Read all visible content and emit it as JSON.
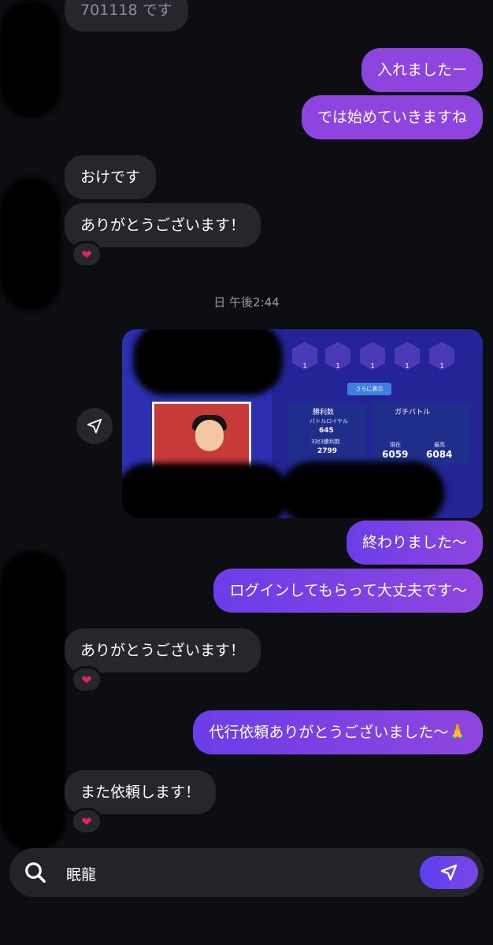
{
  "messages": [
    {
      "id": "m0",
      "side": "in",
      "text": "701118 です"
    },
    {
      "id": "m1",
      "side": "out",
      "text": "入れましたー"
    },
    {
      "id": "m2",
      "side": "out",
      "text": "では始めていきますね"
    },
    {
      "id": "m3",
      "side": "in",
      "text": "おけです"
    },
    {
      "id": "m4",
      "side": "in",
      "text": "ありがとうございます！",
      "reaction": "❤"
    },
    {
      "id": "m5",
      "side": "out",
      "text": "終わりました〜"
    },
    {
      "id": "m6",
      "side": "out",
      "text": "ログインしてもらって大丈夫です〜"
    },
    {
      "id": "m7",
      "side": "in",
      "text": "ありがとうございます！",
      "reaction": "❤"
    },
    {
      "id": "m8",
      "side": "out",
      "text": "代行依頼ありがとうございました〜🙏"
    },
    {
      "id": "m9",
      "side": "in",
      "text": "また依頼します！",
      "reaction": "❤"
    }
  ],
  "timestamp": "日 午後2:44",
  "attachment": {
    "type": "game-screenshot",
    "rank_badges": [
      "1",
      "1",
      "1",
      "1",
      "1"
    ],
    "more_button": "さらに表示",
    "wins_title": "勝利数",
    "battle_royale_label": "バトルロイヤル",
    "battle_royale_wins": "645",
    "trio_label": "3対3勝利数",
    "trio_wins": "2799",
    "ranked_title": "ガチバトル",
    "current_label": "現在",
    "current_value": "6059",
    "highest_label": "最高",
    "highest_value": "6084"
  },
  "input": {
    "value": "眠龍"
  },
  "icons": {
    "search": "search-icon",
    "send": "send-icon",
    "share": "share-icon",
    "reaction": "heart-icon"
  },
  "colors": {
    "background": "#0d0e12",
    "incoming": "#26272c",
    "outgoing_start": "#6b3de8",
    "outgoing_end": "#8f45df",
    "heart": "#e0245e"
  }
}
